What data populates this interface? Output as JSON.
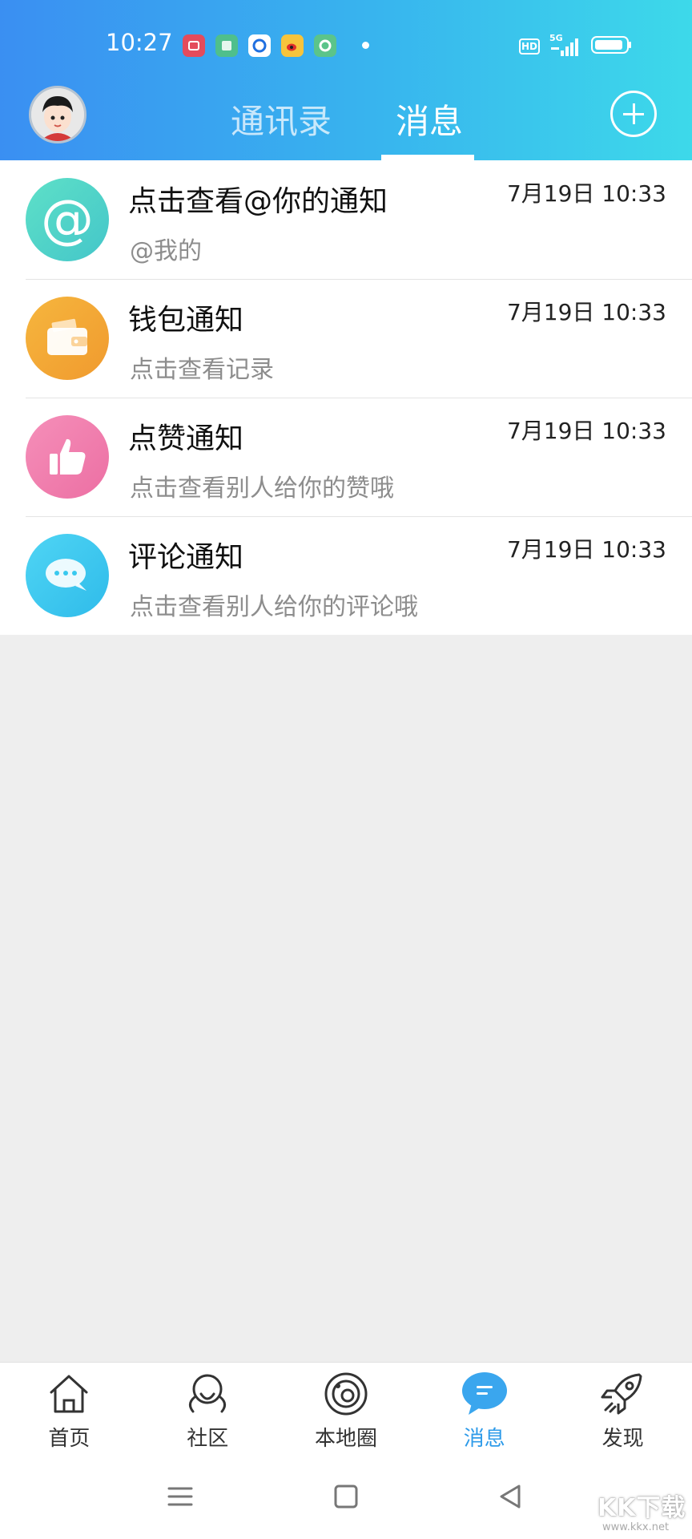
{
  "status_bar": {
    "time": "10:27",
    "network": "5G",
    "hd": "HD",
    "notification_icons": [
      "app-red-icon",
      "app-gallery-icon",
      "app-blue-circle-icon",
      "weibo-icon",
      "app-green-circle-icon"
    ]
  },
  "header": {
    "avatar": "avatar",
    "tabs": [
      {
        "label": "通讯录",
        "active": false
      },
      {
        "label": "消息",
        "active": true
      }
    ],
    "add_button_icon": "plus-circle-icon"
  },
  "messages": [
    {
      "title": "点击查看@你的通知",
      "subtitle": "@我的",
      "time": "7月19日 10:33",
      "icon": "at-icon",
      "color": "#52d3c3"
    },
    {
      "title": "钱包通知",
      "subtitle": "点击查看记录",
      "time": "7月19日 10:33",
      "icon": "wallet-icon",
      "color": "#f4a633"
    },
    {
      "title": "点赞通知",
      "subtitle": "点击查看别人给你的赞哦",
      "time": "7月19日 10:33",
      "icon": "thumbs-up-icon",
      "color": "#f07cac"
    },
    {
      "title": "评论通知",
      "subtitle": "点击查看别人给你的评论哦",
      "time": "7月19日 10:33",
      "icon": "comment-icon",
      "color": "#38c9ef"
    }
  ],
  "tabbar": {
    "items": [
      {
        "label": "首页",
        "icon": "home-icon",
        "active": false
      },
      {
        "label": "社区",
        "icon": "community-icon",
        "active": false
      },
      {
        "label": "本地圈",
        "icon": "local-circle-icon",
        "active": false
      },
      {
        "label": "消息",
        "icon": "message-icon",
        "active": true
      },
      {
        "label": "发现",
        "icon": "rocket-icon",
        "active": false
      }
    ]
  },
  "watermark": {
    "text": "KK下载",
    "sub": "www.kkx.net"
  },
  "colors": {
    "accent": "#2e9be9",
    "header_start": "#3a8ff2",
    "header_end": "#3dd9ea"
  }
}
